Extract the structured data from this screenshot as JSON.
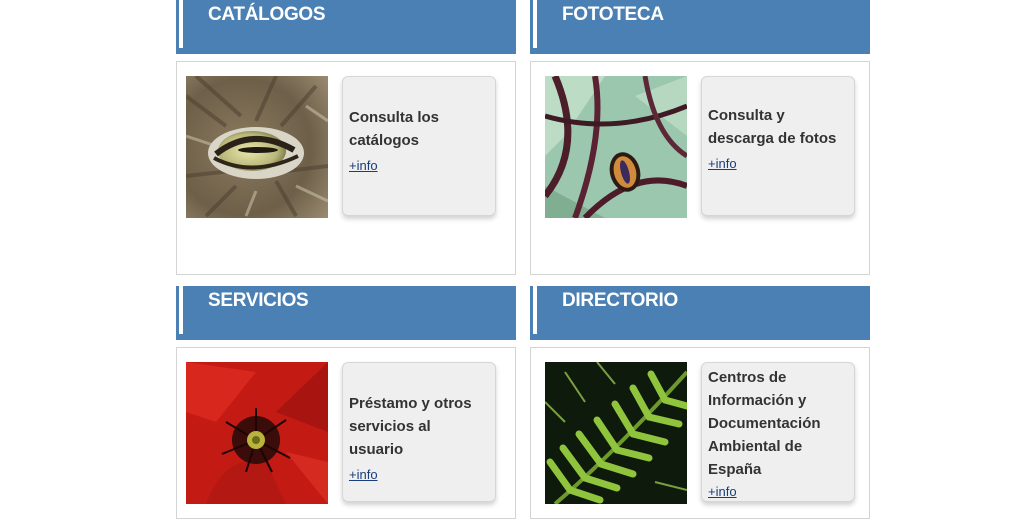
{
  "panels": [
    {
      "title": "CATÁLOGOS",
      "description": "Consulta los catálogos",
      "link": "+info",
      "image": "lynx-eye-photo"
    },
    {
      "title": "FOTOTECA",
      "description": "Consulta y descarga de fotos",
      "link": "+info",
      "image": "moth-wing-photo"
    },
    {
      "title": "SERVICIOS",
      "description": "Préstamo y otros servicios al usuario",
      "link": "+info",
      "image": "red-poppy-photo"
    },
    {
      "title": "DIRECTORIO",
      "description": "Centros de Información y Documentación Ambiental de España",
      "link": "+info",
      "image": "fern-leaf-photo"
    }
  ],
  "colors": {
    "header": "#4a80b4",
    "card": "#efefef",
    "link": "#1a3d7c"
  }
}
